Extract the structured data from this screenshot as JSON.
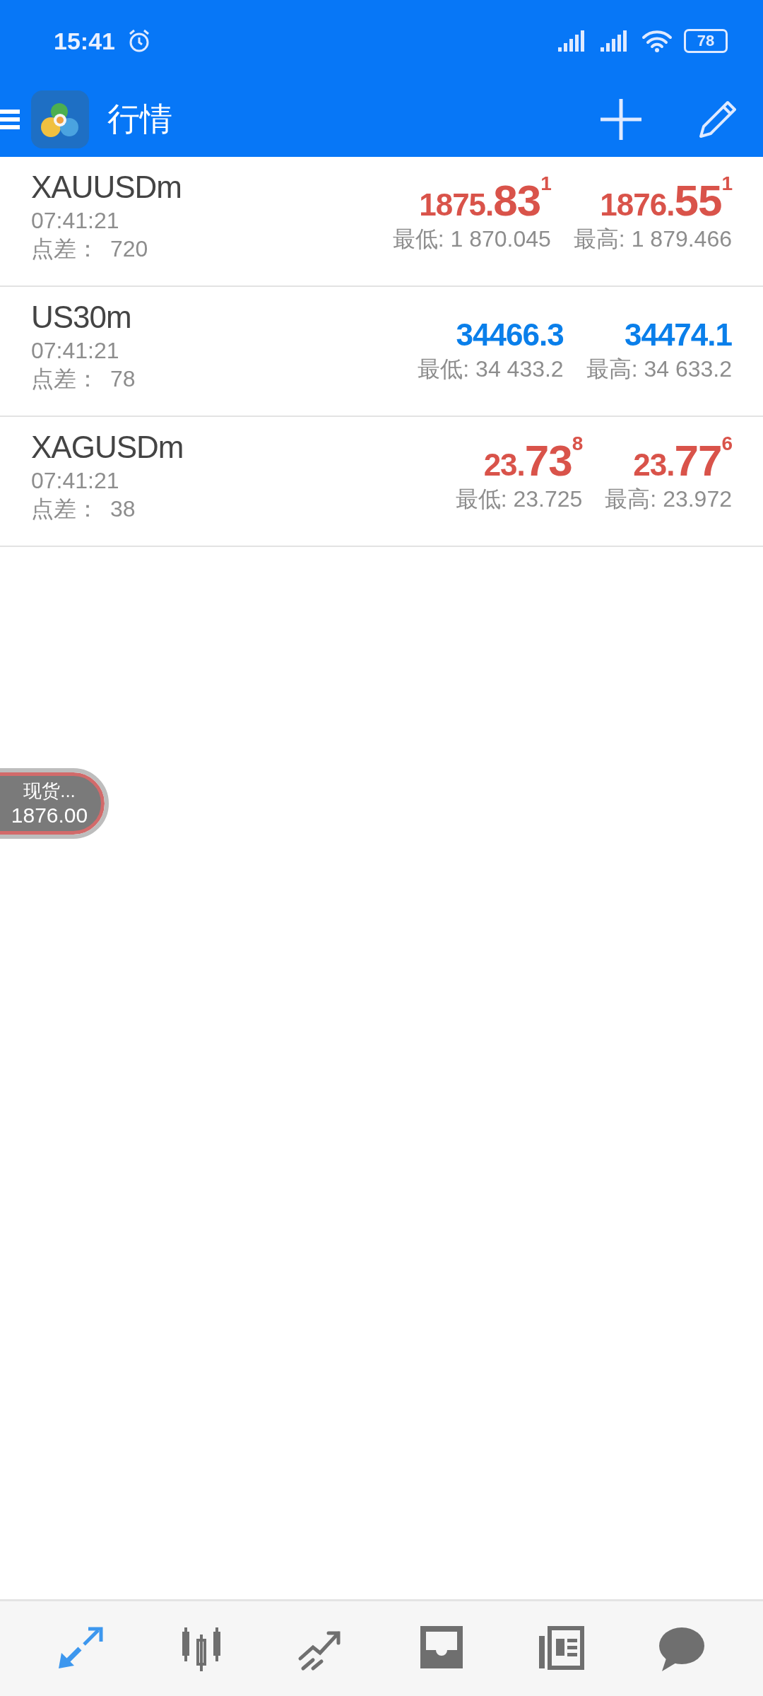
{
  "status_bar": {
    "time": "15:41",
    "battery": "78"
  },
  "app_bar": {
    "title": "行情"
  },
  "quotes": [
    {
      "symbol": "XAUUSDm",
      "time": "07:41:21",
      "spread_label": "点差：",
      "spread": "720",
      "bid": {
        "head": "1875.",
        "big": "83",
        "sup": "1",
        "color": "#d9534a"
      },
      "ask": {
        "head": "1876.",
        "big": "55",
        "sup": "1",
        "color": "#d9534a"
      },
      "low": "最低: 1 870.045",
      "high": "最高: 1 879.466"
    },
    {
      "symbol": "US30m",
      "time": "07:41:21",
      "spread_label": "点差：",
      "spread": "78",
      "bid": {
        "head": "34466.3",
        "color": "#0a7fea"
      },
      "ask": {
        "head": "34474.1",
        "color": "#0a7fea"
      },
      "low": "最低: 34 433.2",
      "high": "最高: 34 633.2"
    },
    {
      "symbol": "XAGUSDm",
      "time": "07:41:21",
      "spread_label": "点差：",
      "spread": "38",
      "bid": {
        "head": "23.",
        "big": "73",
        "sup": "8",
        "color": "#d9534a"
      },
      "ask": {
        "head": "23.",
        "big": "77",
        "sup": "6",
        "color": "#d9534a"
      },
      "low": "最低: 23.725",
      "high": "最高: 23.972"
    }
  ],
  "floating_quote": {
    "label": "现货...",
    "price": "1876.00"
  },
  "bottom_nav": [
    {
      "kind": "quotes",
      "selected": true
    },
    {
      "kind": "chart",
      "selected": false
    },
    {
      "kind": "trade",
      "selected": false
    },
    {
      "kind": "history",
      "selected": false
    },
    {
      "kind": "news",
      "selected": false
    },
    {
      "kind": "chat",
      "selected": false
    }
  ]
}
